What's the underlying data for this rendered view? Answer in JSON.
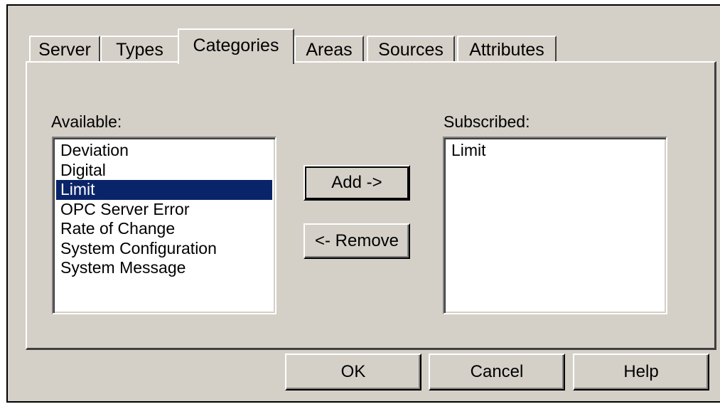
{
  "tabs": [
    {
      "label": "Server"
    },
    {
      "label": "Types"
    },
    {
      "label": "Categories",
      "active": true
    },
    {
      "label": "Areas"
    },
    {
      "label": "Sources"
    },
    {
      "label": "Attributes"
    }
  ],
  "available": {
    "label": "Available:",
    "items": [
      "Deviation",
      "Digital",
      "Limit",
      "OPC Server Error",
      "Rate of Change",
      "System Configuration",
      "System Message"
    ],
    "selected": "Limit"
  },
  "subscribed": {
    "label": "Subscribed:",
    "items": [
      "Limit"
    ]
  },
  "buttons": {
    "add": "Add ->",
    "remove": "<- Remove",
    "ok": "OK",
    "cancel": "Cancel",
    "help": "Help"
  },
  "colors": {
    "dialog_bg": "#d4d0c8",
    "selection": "#0a246a"
  }
}
